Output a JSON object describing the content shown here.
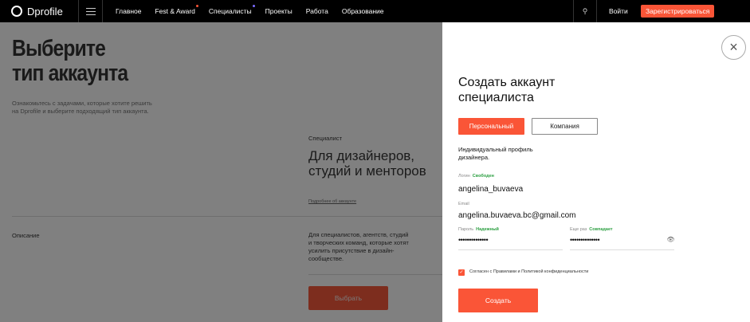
{
  "header": {
    "logo": "Dprofile",
    "nav": [
      {
        "label": "Главное"
      },
      {
        "label": "Fest & Award",
        "dot": "#fa5537"
      },
      {
        "label": "Специалисты",
        "dot": "#7b6cff"
      },
      {
        "label": "Проекты"
      },
      {
        "label": "Работа"
      },
      {
        "label": "Образование"
      }
    ],
    "login": "Войти",
    "register": "Зарегистрироваться"
  },
  "page": {
    "title": "Выберите тип аккаунта",
    "intro": "Ознакомьтесь с задачами, которые хотите решить на Dprofile и выберите подходящий тип аккаунта.",
    "type_label": "Специалист",
    "headline": "Для дизайнеров, студий и менторов",
    "more_link": "Подробнее об аккаунте",
    "desc_label": "Описание",
    "description": "Для специалистов, агентств, студий и творческих команд, которые хотят усилить присутствие в дизайн-сообществе.",
    "choose": "Выбрать"
  },
  "modal": {
    "title": "Создать аккаунт специалиста",
    "tabs": [
      "Персональный",
      "Компания"
    ],
    "tab_desc": "Индивидуальный профиль дизайнера.",
    "login_label": "Логин",
    "login_status": "Свободен",
    "login_value": "angelina_buvaeva",
    "email_label": "Email",
    "email_value": "angelina.buvaeva.bc@gmail.com",
    "password_label": "Пароль",
    "password_status": "Надежный",
    "password_value": "••••••••••••••",
    "repeat_label": "Еще раз",
    "repeat_status": "Совпадает",
    "repeat_value": "••••••••••••••",
    "agree": "Согласен с Правилами и Политикой конфиденциальности",
    "create": "Создать",
    "accent": "#fa5537"
  }
}
